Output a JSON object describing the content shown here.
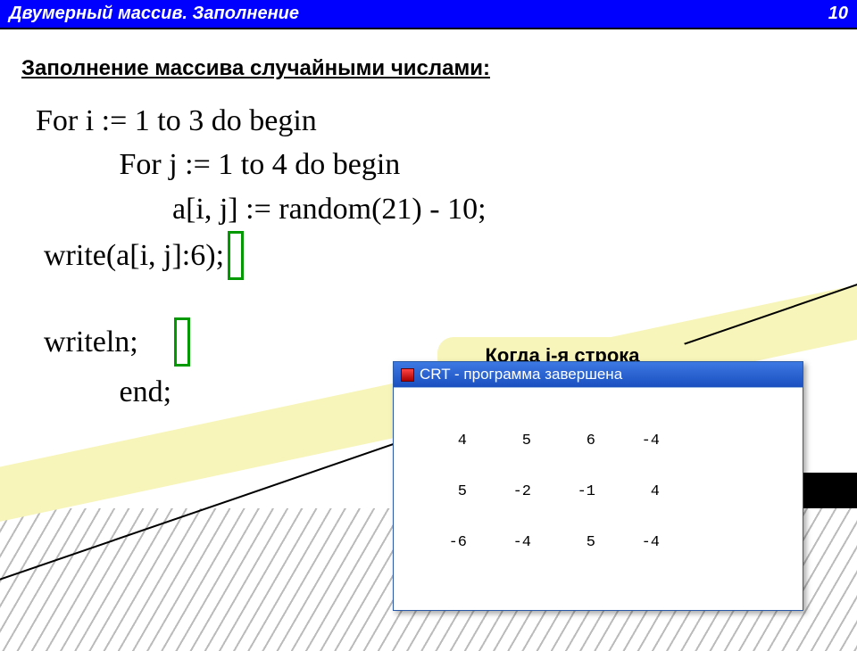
{
  "header": {
    "title": "Двумерный массив. Заполнение",
    "page_number": "10"
  },
  "subtitle": "Заполнение массива случайными числами:",
  "code": {
    "l1": "For i := 1 to 3 do begin",
    "l2": "           For j := 1 to 4 do begin",
    "l3": "                  a[i, j] := random(21) - 10;",
    "l4": "                  write(a[i, j]:6);",
    "l5": "           writeln;",
    "l6": "           end;"
  },
  "callout": "Когда i-я строка",
  "crt": {
    "title": "CRT - программа завершена",
    "rows": [
      [
        "4",
        "5",
        "6",
        "-4"
      ],
      [
        "5",
        "-2",
        "-1",
        "4"
      ],
      [
        "-6",
        "-4",
        "5",
        "-4"
      ]
    ]
  }
}
